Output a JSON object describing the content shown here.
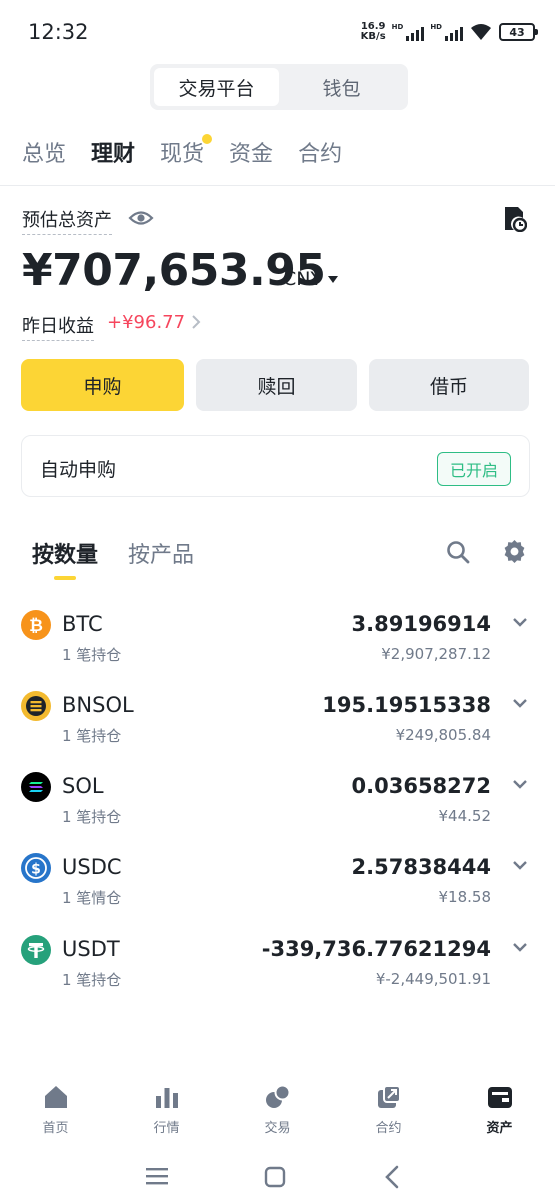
{
  "status": {
    "time": "12:32",
    "net_speed_value": "16.9",
    "net_speed_unit": "KB/s",
    "hd1": "HD",
    "hd2": "HD",
    "battery": "43"
  },
  "segment": {
    "items": [
      "交易平台",
      "钱包"
    ],
    "active": 0
  },
  "top_tabs": {
    "items": [
      "总览",
      "理财",
      "现货",
      "资金",
      "合约"
    ],
    "active": 1,
    "dot_on": 2
  },
  "summary": {
    "est_label": "预估总资产",
    "total": "¥707,653.95",
    "currency": "CNY",
    "yesterday_label": "昨日收益",
    "yesterday_value": "+¥96.77"
  },
  "actions": {
    "subscribe": "申购",
    "redeem": "赎回",
    "borrow": "借币"
  },
  "auto": {
    "label": "自动申购",
    "badge": "已开启"
  },
  "list_tabs": {
    "items": [
      "按数量",
      "按产品"
    ],
    "active": 0
  },
  "assets": [
    {
      "symbol": "BTC",
      "sub": "1 笔持仓",
      "amount": "3.89196914",
      "value": "¥2,907,287.12",
      "icon": "btc-icon",
      "color": "#f7931a"
    },
    {
      "symbol": "BNSOL",
      "sub": "1 笔持仓",
      "amount": "195.19515338",
      "value": "¥249,805.84",
      "icon": "bnsol-icon",
      "color": "#f3ba2f"
    },
    {
      "symbol": "SOL",
      "sub": "1 笔持仓",
      "amount": "0.03658272",
      "value": "¥44.52",
      "icon": "sol-icon",
      "color": "#000000"
    },
    {
      "symbol": "USDC",
      "sub": "1 笔情仓",
      "amount": "2.57838444",
      "value": "¥18.58",
      "icon": "usdc-icon",
      "color": "#2775ca"
    },
    {
      "symbol": "USDT",
      "sub": "1 笔持仓",
      "amount": "-339,736.77621294",
      "value": "¥-2,449,501.91",
      "icon": "usdt-icon",
      "color": "#26a17b"
    }
  ],
  "bottom_nav": {
    "items": [
      "首页",
      "行情",
      "交易",
      "合约",
      "资产"
    ],
    "active": 4
  },
  "colors": {
    "brand": "#fcd535",
    "loss": "#f6465d",
    "gain": "#2ebd85",
    "text": "#1e2329",
    "muted": "#707a8a"
  }
}
